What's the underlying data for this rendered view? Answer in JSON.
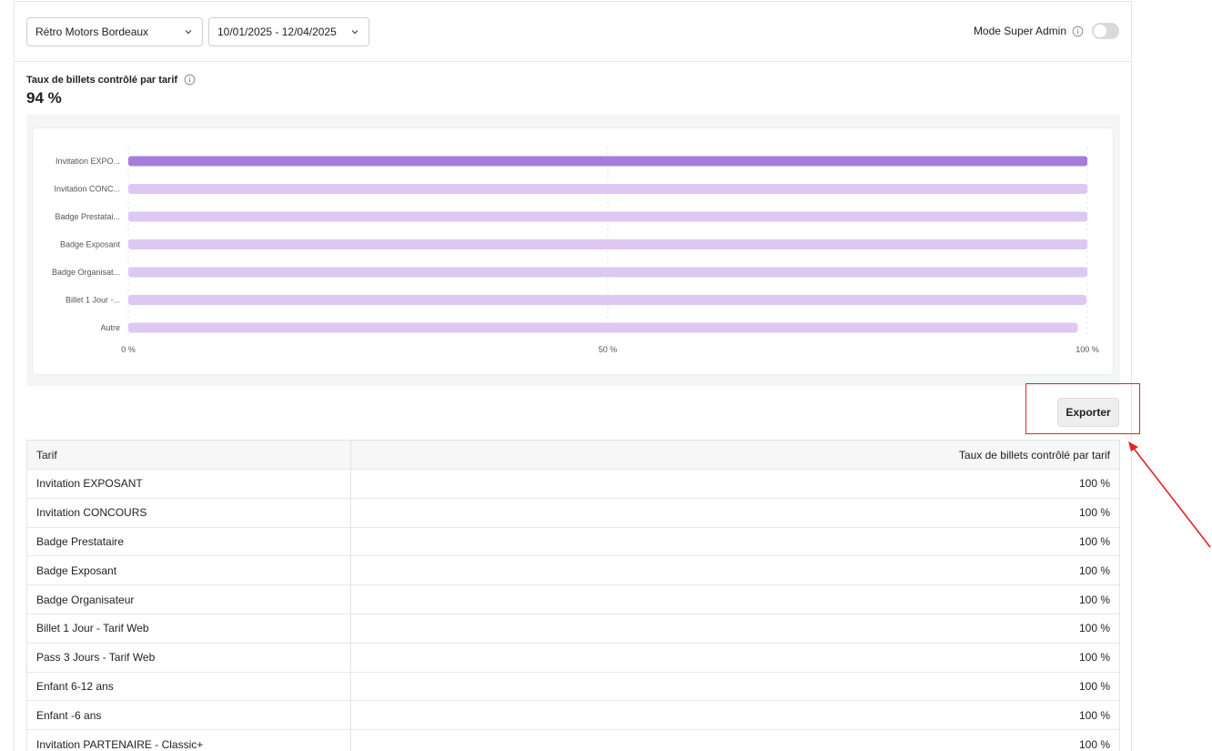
{
  "filters": {
    "venue": "Rétro Motors Bordeaux",
    "date_range": "10/01/2025 - 12/04/2025"
  },
  "admin": {
    "label": "Mode Super Admin",
    "enabled": false
  },
  "metric": {
    "title": "Taux de billets contrôlé par tarif",
    "value": "94 %"
  },
  "chart_data": {
    "type": "bar",
    "orientation": "horizontal",
    "categories": [
      "Invitation EXPO...",
      "Invitation CONC...",
      "Badge Prestatai...",
      "Badge Exposant",
      "Badge Organisat...",
      "Billet 1 Jour -...",
      "Autre"
    ],
    "values": [
      100,
      100,
      100,
      100,
      100,
      99.9,
      99
    ],
    "highlighted_index": 0,
    "xlim": [
      0,
      100
    ],
    "x_ticks": [
      "0 %",
      "50 %",
      "100 %"
    ],
    "colors": {
      "highlight": "#a57ddc",
      "default": "#ddc8f2"
    },
    "grid": true
  },
  "export_button": "Exporter",
  "table": {
    "headers": [
      "Tarif",
      "Taux de billets contrôlé par tarif"
    ],
    "rows": [
      [
        "Invitation EXPOSANT",
        "100 %"
      ],
      [
        "Invitation CONCOURS",
        "100 %"
      ],
      [
        "Badge Prestataire",
        "100 %"
      ],
      [
        "Badge Exposant",
        "100 %"
      ],
      [
        "Badge Organisateur",
        "100 %"
      ],
      [
        "Billet 1 Jour - Tarif Web",
        "100 %"
      ],
      [
        "Pass 3 Jours - Tarif Web",
        "100 %"
      ],
      [
        "Enfant 6-12 ans",
        "100 %"
      ],
      [
        "Enfant -6 ans",
        "100 %"
      ],
      [
        "Invitation PARTENAIRE - Classic+",
        "100 %"
      ]
    ]
  },
  "annotation_color": "#e02424"
}
